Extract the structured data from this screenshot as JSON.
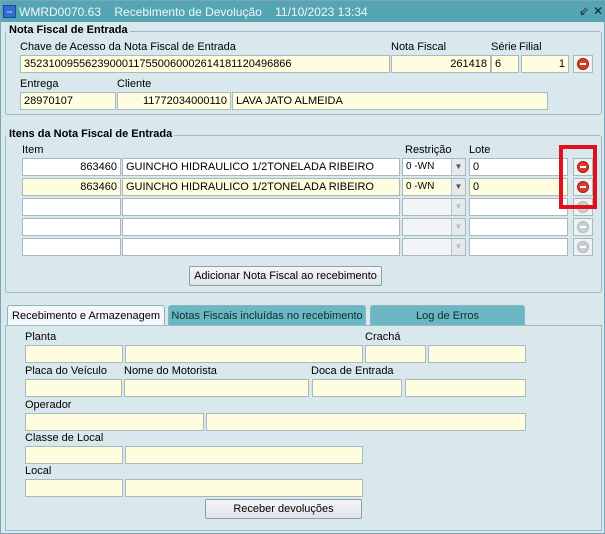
{
  "titlebar": {
    "app_code": "WMRD0070.63",
    "title": "Recebimento de Devolução",
    "datetime": "11/10/2023 13:34",
    "minimize_glyph": "⇙",
    "close_glyph": "✕"
  },
  "nota_fiscal": {
    "section_title": "Nota Fiscal de Entrada",
    "chave_label": "Chave de Acesso da Nota Fiscal de Entrada",
    "chave_value": "35231009556239000117550060002614181120496866",
    "nota_label": "Nota Fiscal",
    "nota_value": "261418",
    "serie_label": "Série",
    "serie_value": "6",
    "filial_label": "Filial",
    "filial_value": "1",
    "entrega_label": "Entrega",
    "entrega_value": "28970107",
    "cliente_label": "Cliente",
    "cliente_code": "11772034000110",
    "cliente_name": "LAVA  JATO ALMEIDA"
  },
  "itens": {
    "section_title": "Itens da Nota Fiscal de Entrada",
    "col_item": "Item",
    "col_restricao": "Restrição",
    "col_lote": "Lote",
    "rows": [
      {
        "item": "863460",
        "desc": "GUINCHO HIDRAULICO 1/2TONELADA RIBEIRO",
        "restricao": "0  -WN",
        "lote": "0"
      },
      {
        "item": "863460",
        "desc": "GUINCHO HIDRAULICO 1/2TONELADA RIBEIRO",
        "restricao": "0  -WN",
        "lote": "0"
      },
      {
        "item": "",
        "desc": "",
        "restricao": "",
        "lote": ""
      },
      {
        "item": "",
        "desc": "",
        "restricao": "",
        "lote": ""
      },
      {
        "item": "",
        "desc": "",
        "restricao": "",
        "lote": ""
      }
    ],
    "add_button": "Adicionar Nota Fiscal ao recebimento"
  },
  "tabs": {
    "tab1": "Recebimento e Armazenagem",
    "tab2": "Notas Fiscais incluídas no recebimento",
    "tab3": "Log de Erros"
  },
  "recebimento": {
    "planta_label": "Planta",
    "cracha_label": "Crachá",
    "placa_label": "Placa do Veículo",
    "motorista_label": "Nome do Motorista",
    "doca_label": "Doca de Entrada",
    "operador_label": "Operador",
    "classe_label": "Classe de Local",
    "local_label": "Local",
    "receber_button": "Receber devoluções"
  },
  "colors": {
    "titlebar": "#56a5b5",
    "window_bg": "#d8e8ec",
    "field_bg": "#fffde0",
    "remove_red": "#e03a2a",
    "highlight": "#e0101e"
  }
}
